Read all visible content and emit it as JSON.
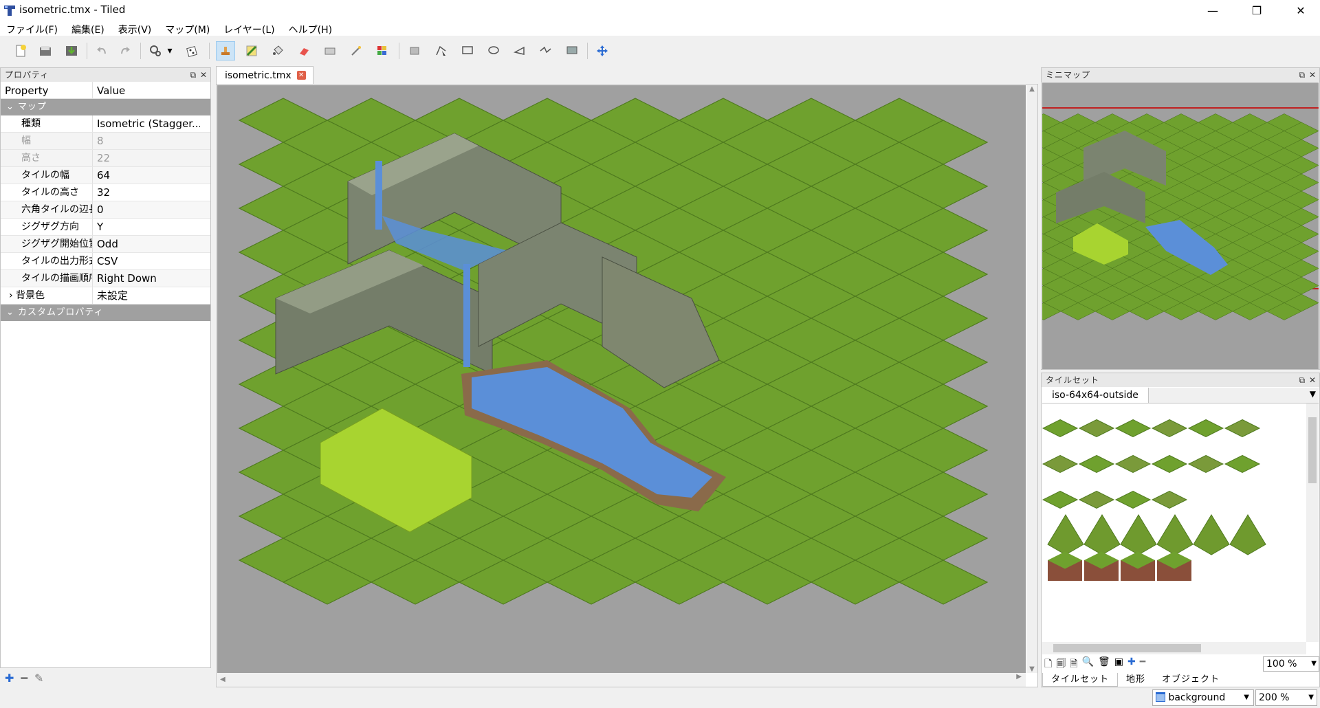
{
  "window": {
    "title": "isometric.tmx - Tiled",
    "minimize": "—",
    "maximize": "❐",
    "close": "✕"
  },
  "menu": [
    "ファイル(F)",
    "編集(E)",
    "表示(V)",
    "マップ(M)",
    "レイヤー(L)",
    "ヘルプ(H)"
  ],
  "toolbar": {
    "icons": [
      "new-file-icon",
      "open-file-icon",
      "save-icon",
      "undo-icon",
      "redo-icon",
      "commands-icon",
      "random-icon",
      "stamp-brush-icon",
      "terrain-brush-icon",
      "bucket-fill-icon",
      "eraser-icon",
      "rectangle-select-icon",
      "magic-wand-icon",
      "select-same-tile-icon",
      "select-objects-icon",
      "edit-polygons-icon",
      "insert-rectangle-icon",
      "insert-ellipse-icon",
      "insert-polygon-icon",
      "insert-polyline-icon",
      "insert-tile-icon",
      "move-icon"
    ]
  },
  "properties": {
    "title": "プロパティ",
    "col_property": "Property",
    "col_value": "Value",
    "group_map": "マップ",
    "rows": [
      {
        "key": "種類",
        "value": "Isometric (Stagger..."
      },
      {
        "key": "幅",
        "value": "8"
      },
      {
        "key": "高さ",
        "value": "22"
      },
      {
        "key": "タイルの幅",
        "value": "64"
      },
      {
        "key": "タイルの高さ",
        "value": "32"
      },
      {
        "key": "六角タイルの辺長",
        "value": "0"
      },
      {
        "key": "ジグザグ方向",
        "value": "Y"
      },
      {
        "key": "ジグザグ開始位置",
        "value": "Odd"
      },
      {
        "key": "タイルの出力形式",
        "value": "CSV"
      },
      {
        "key": "タイルの描画順序",
        "value": "Right Down"
      },
      {
        "key": "背景色",
        "value": "未設定"
      }
    ],
    "group_custom": "カスタムプロパティ"
  },
  "document": {
    "tab_label": "isometric.tmx"
  },
  "minimap": {
    "title": "ミニマップ"
  },
  "tileset": {
    "title": "タイルセット",
    "selected": "iso-64x64-outside",
    "zoom": "100 %",
    "tabs": [
      "タイルセット",
      "地形",
      "オブジェクト"
    ]
  },
  "status": {
    "layer": "background",
    "zoom": "200 %"
  },
  "colors": {
    "grass": "#6fa12e",
    "grass_dark": "#4f7a1f",
    "water": "#5b8fd8",
    "rock": "#7d8570",
    "tall_grass": "#a8d430",
    "dirt": "#8a6a4a"
  }
}
